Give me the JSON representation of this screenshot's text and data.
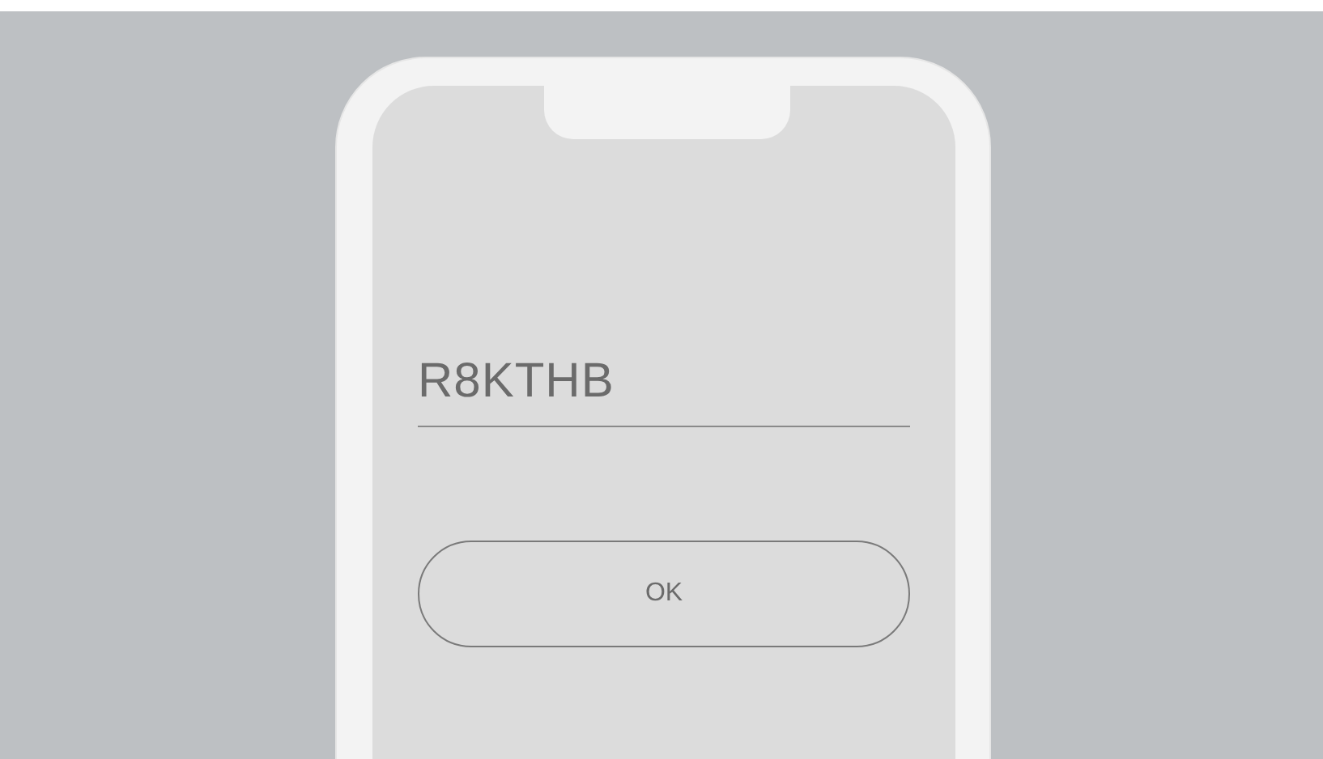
{
  "code_field": {
    "value": "R8KTHB"
  },
  "buttons": [
    {
      "label": "OK"
    }
  ]
}
